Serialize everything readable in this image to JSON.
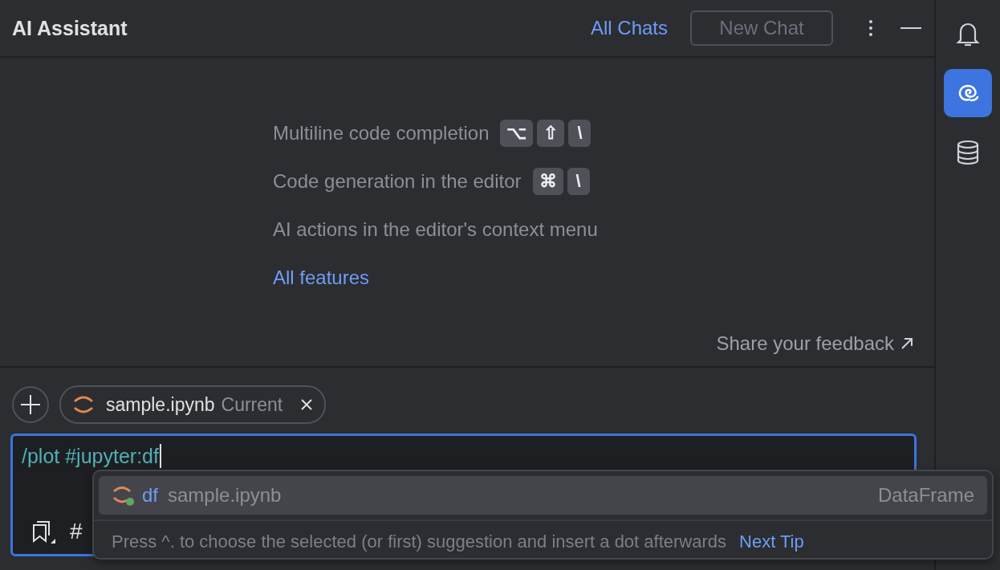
{
  "header": {
    "title": "AI Assistant",
    "all_chats": "All Chats",
    "new_chat": {
      "label": "New Chat",
      "disabled": true
    }
  },
  "features": [
    {
      "text": "Multiline code completion",
      "keys": [
        "⌥",
        "⇧",
        "\\"
      ]
    },
    {
      "text": "Code generation in the editor",
      "keys": [
        "⌘",
        "\\"
      ]
    },
    {
      "text": "AI actions in the editor's context menu"
    }
  ],
  "all_features": "All features",
  "feedback": "Share your feedback",
  "context_chip": {
    "file": "sample.ipynb",
    "tag": "Current"
  },
  "input": {
    "value": "/plot #jupyter:df",
    "toolbar": [
      "#"
    ]
  },
  "popup": {
    "items": [
      {
        "name": "df",
        "file": "sample.ipynb",
        "type": "DataFrame",
        "selected": true
      }
    ],
    "hint": "Press ^. to choose the selected (or first) suggestion and insert a dot afterwards",
    "next_tip": "Next Tip"
  },
  "tool_strip": [
    {
      "kind": "bell",
      "selected": false
    },
    {
      "kind": "ai",
      "selected": true
    },
    {
      "kind": "database",
      "selected": false
    }
  ]
}
